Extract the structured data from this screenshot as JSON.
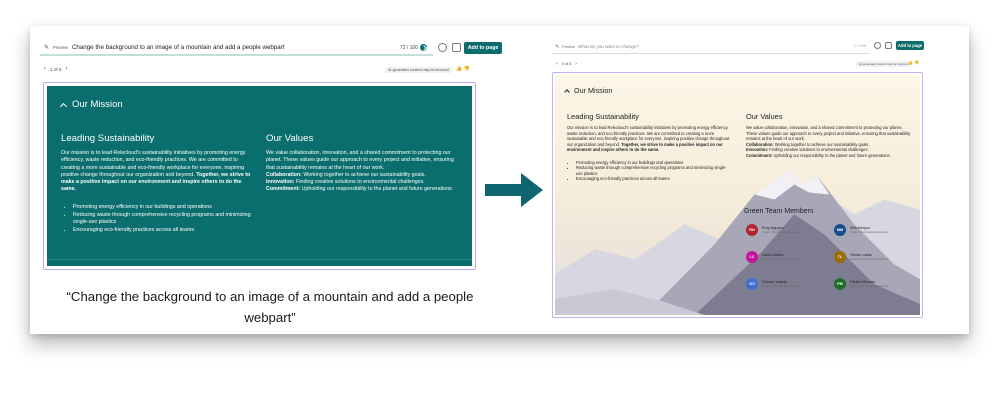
{
  "left": {
    "preview_tag": "Preview",
    "prompt": "Change the background to an image of a mountain and add a people webpart",
    "counter": "72 / 100",
    "add_button": "Add to page",
    "pager": "1 of 5",
    "ai_note": "AI-generated content may be incorrect",
    "section_title": "Our Mission",
    "col1_title": "Leading Sustainability",
    "col1_body": "Our mission is to lead Relecloud's sustainability initiatives by promoting energy efficiency, waste reduction, and eco-friendly practices. We are committed to creating a more sustainable and eco-friendly workplace for everyone, inspiring positive change throughout our organization and beyond.",
    "col1_bold": "Together, we strive to make a positive impact on our environment and inspire others to do the same.",
    "bullets": [
      "Promoting energy efficiency in our buildings and operations",
      "Reducing waste through comprehensive recycling programs and minimizing single-use plastics",
      "Encouraging eco-friendly practices across all teams"
    ],
    "col2_title": "Our Values",
    "col2_body": "We value collaboration, innovation, and a shared commitment to protecting our planet. These values guide our approach to every project and initiative, ensuring that sustainability remains at the heart of our work.",
    "values": [
      {
        "label": "Collaboration:",
        "text": " Working together to achieve our sustainability goals."
      },
      {
        "label": "Innovation:",
        "text": " Finding creative solutions to environmental challenges."
      },
      {
        "label": "Commitment:",
        "text": " Upholding our responsibility to the planet and future generations."
      }
    ]
  },
  "caption": "“Change the background to an image of a mountain and add a people webpart”",
  "right": {
    "preview_tag": "Preview",
    "placeholder": "What do you want to change?",
    "counter": "0 / 100",
    "add_button": "Add to page",
    "pager": "4 of 5",
    "ai_note": "AI-generated content may be incorrect",
    "section_title": "Our Mission",
    "col1_title": "Leading Sustainability",
    "col1_body": "Our mission is to lead Relecloud's sustainability initiatives by promoting energy efficiency, waste reduction, and eco-friendly practices. We are committed to creating a more sustainable and eco-friendly workplace for everyone, inspiring positive change throughout our organization and beyond.",
    "col1_bold": "Together, we strive to make a positive impact on our environment and inspire others to do the same.",
    "bullets": [
      "Promoting energy efficiency in our buildings and operations",
      "Reducing waste through comprehensive recycling programs and minimizing single-use plastics",
      "Encouraging eco-friendly practices across all teams"
    ],
    "col2_title": "Our Values",
    "col2_body": "We value collaboration, innovation, and a shared commitment to protecting our planet. These values guide our approach to every project and initiative, ensuring that sustainability remains at the heart of our work.",
    "values": [
      {
        "label": "Collaboration:",
        "text": " Working together to achieve our sustainability goals."
      },
      {
        "label": "Innovation:",
        "text": " Finding creative solutions to environmental challenges."
      },
      {
        "label": "Commitment:",
        "text": " Upholding our responsibility to the planet and future generations."
      }
    ],
    "team_title": "Green Team Members",
    "people": [
      {
        "initials": "RN",
        "name": "Rory Nguyen",
        "role": "Senior Mechanical Engineer",
        "color": "#b3262d"
      },
      {
        "initials": "MM",
        "name": "Mila Morpus",
        "role": "Senior Mechanical Engineer",
        "color": "#164d8c"
      },
      {
        "initials": "LC",
        "name": "Laura Cunha",
        "role": "Senior Mechanical Engineer",
        "color": "#c2139a"
      },
      {
        "initials": "TL",
        "name": "Tomas Lukac",
        "role": "Senior Mechanical Engineer",
        "color": "#9a6b00"
      },
      {
        "initials": "GV",
        "name": "Gordan Vukelic",
        "role": "Senior Mechanical Engineer",
        "color": "#3f6fd0"
      },
      {
        "initials": "PM",
        "name": "Parker McLean",
        "role": "Senior Mechanical Engineer",
        "color": "#1f6b2a"
      }
    ]
  },
  "colors": {
    "teal": "#0a6e6e",
    "accent_button": "#0f6c6c",
    "frame": "#b9a8f0"
  },
  "icons": [
    "sparkle-icon",
    "send-icon",
    "refresh-icon",
    "compare-icon",
    "chevron-left-icon",
    "chevron-right-icon",
    "thumbs-up-icon",
    "thumbs-down-icon",
    "collapse-chevron-icon",
    "arrow-right-icon"
  ]
}
